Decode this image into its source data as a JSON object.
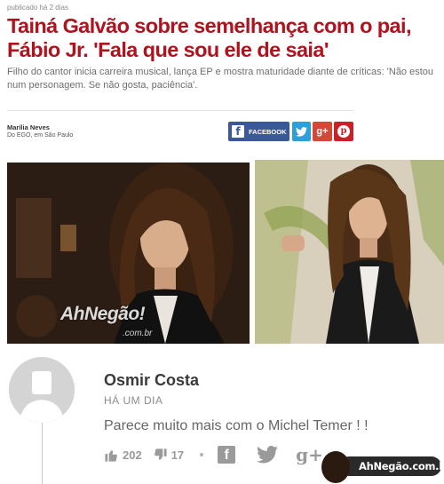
{
  "article": {
    "published": "publicado há 2 dias",
    "headline": "Tainá Galvão sobre semelhança com o pai, Fábio Jr. 'Fala que sou ele de saia'",
    "subtitle": "Filho do cantor inicia carreira musical, lança EP e mostra maturidade diante de críticas: 'Não estou num personagem. Se não gosta, paciência'.",
    "author_name": "Marília Neves",
    "author_org": "Do EGO, em São Paulo"
  },
  "share": {
    "facebook_label": "FACEBOOK",
    "facebook_glyph": "f",
    "googleplus_glyph": "g+",
    "pinterest_glyph": "p"
  },
  "photos": {
    "watermark_text": "AhNegão!",
    "watermark_sub": ".com.br"
  },
  "comment": {
    "author": "Osmir Costa",
    "time": "HÁ UM DIA",
    "text": "Parece muito mais com o Michel Temer ! !",
    "likes": "202",
    "dislikes": "17",
    "facebook_glyph": "f",
    "googleplus_glyph": "g+"
  },
  "badge": {
    "text": "AhNegão.com.br"
  },
  "colors": {
    "headline": "#b0131d",
    "facebook": "#3b5998",
    "twitter": "#2d9fdb",
    "googleplus": "#d34836",
    "pinterest": "#cb2027"
  },
  "icons": [
    "facebook-icon",
    "twitter-icon",
    "google-plus-icon",
    "pinterest-icon",
    "thumbs-up-icon",
    "thumbs-down-icon",
    "user-avatar-icon"
  ]
}
